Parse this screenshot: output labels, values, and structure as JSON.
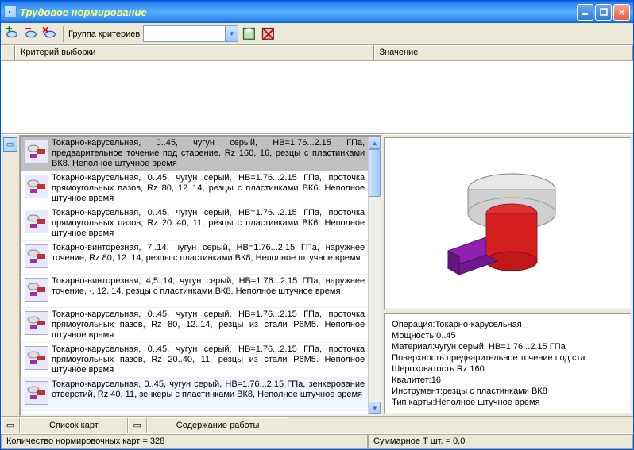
{
  "window": {
    "title": "Трудовое нормирование"
  },
  "toolbar": {
    "group_label": "Группа критериев",
    "combo_value": ""
  },
  "criteria": {
    "col_criteria": "Критерий выборки",
    "col_value": "Значение"
  },
  "list": {
    "items": [
      "Токарно-карусельная, 0..45, чугун серый, HB=1.76...2.15 ГПа, предварительное точение под старение, Rz 160, 16, резцы с пластинками ВК8. Неполное штучное время",
      "Токарно-карусельная, 0..45, чугун серый, HB=1.76...2.15 ГПа, проточка прямоугольных пазов, Rz 80, 12..14, резцы с пластинками ВК6. Неполное штучное время",
      "Токарно-карусельная, 0..45, чугун серый, HB=1.76...2.15 ГПа, проточка прямоугольных пазов, Rz 20..40, 11, резцы с пластинками ВК6. Неполное штучное время",
      "Токарно-винторезная, 7..14, чугун серый, HB=1.76...2.15 ГПа, наружнее точение, Rz 80, 12..14, резцы с пластинками ВК8, Неполное штучное время",
      "Токарно-винторезная, 4,5..14, чугун серый, HB=1.76...2.15 ГПа, наружнее точение, -, 12..14, резцы с пластинками ВК8, Неполное штучное время",
      "Токарно-карусельная, 0..45, чугун серый, HB=1.76...2.15 ГПа, проточка прямоугольных пазов, Rz 80, 12..14, резцы из стали Р6М5. Неполное штучное время",
      "Токарно-карусельная, 0..45, чугун серый, HB=1.76...2.15 ГПа, проточка прямоугольных пазов, Rz 20..40, 11, резцы из стали Р6М5. Неполное штучное время",
      "Токарно-карусельная, 0..45, чугун серый, HB=1.76...2.15 ГПа, зенкерование отверстий, Rz 40, 11, зенкеры с пластинками ВК8, Неполное штучное время"
    ]
  },
  "details": {
    "rows": [
      {
        "label": "Операция:",
        "value": " Токарно-карусельная"
      },
      {
        "label": "Мощность:",
        "value": " 0..45"
      },
      {
        "label": "Материал:",
        "value": " чугун серый, HB=1.76...2.15 ГПа"
      },
      {
        "label": "Поверхность:",
        "value": " предварительное точение под ста"
      },
      {
        "label": "Шероховатость:",
        "value": " Rz 160"
      },
      {
        "label": "Квалитет:",
        "value": " 16"
      },
      {
        "label": "Инструмент:",
        "value": " резцы с пластинками ВК8"
      },
      {
        "label": "Тип карты:",
        "value": " Неполное штучное время"
      }
    ]
  },
  "tabs": {
    "list": "Список карт",
    "content": "Содержание работы"
  },
  "status": {
    "count": "Количество нормировочных карт = 328",
    "sum": "Суммарное Т шт. = 0,0"
  }
}
